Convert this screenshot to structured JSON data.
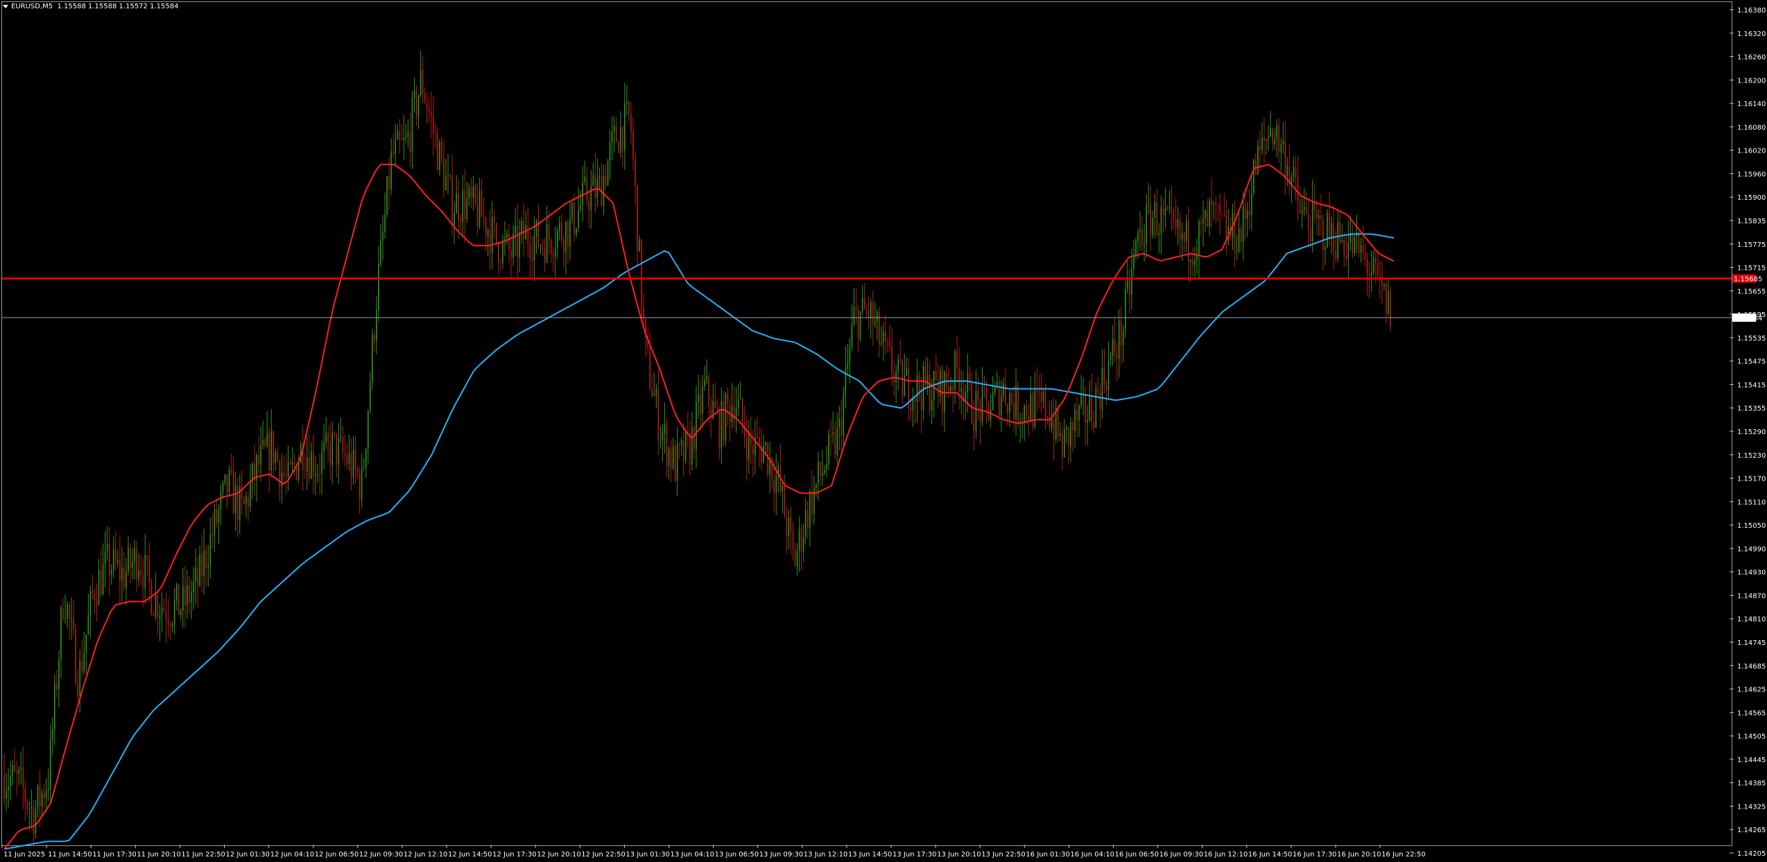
{
  "header": {
    "symbol": "EURUSD,M5",
    "ohlc": "1.15588 1.15588 1.15572 1.15584"
  },
  "colors": {
    "background": "#000000",
    "bull_candle": "#2e9a1e",
    "bear_candle": "#b41e1e",
    "ma_fast": "#ff2020",
    "ma_slow": "#22b4ff",
    "hline": "#e00000",
    "bid_line": "#9aa4ad"
  },
  "chart_data": {
    "type": "candlestick",
    "title": "",
    "xlabel": "",
    "ylabel": "",
    "grid": false,
    "ylim": [
      1.142,
      1.1638
    ],
    "y_ticks": [
      "1.16380",
      "1.16320",
      "1.16260",
      "1.16200",
      "1.16140",
      "1.16080",
      "1.16020",
      "1.15960",
      "1.15900",
      "1.15835",
      "1.15775",
      "1.15715",
      "1.15655",
      "1.15595",
      "1.15535",
      "1.15475",
      "1.15415",
      "1.15355",
      "1.15290",
      "1.15230",
      "1.15170",
      "1.15110",
      "1.15050",
      "1.14990",
      "1.14930",
      "1.14870",
      "1.14810",
      "1.14745",
      "1.14685",
      "1.14625",
      "1.14565",
      "1.14505",
      "1.14445",
      "1.14385",
      "1.14325",
      "1.14265",
      "1.14205"
    ],
    "x_ticks": [
      "11 Jun 2025",
      "11 Jun 14:50",
      "11 Jun 17:30",
      "11 Jun 20:10",
      "11 Jun 22:50",
      "12 Jun 01:30",
      "12 Jun 04:10",
      "12 Jun 06:50",
      "12 Jun 09:30",
      "12 Jun 12:10",
      "12 Jun 14:50",
      "12 Jun 17:30",
      "12 Jun 20:10",
      "12 Jun 22:50",
      "13 Jun 01:30",
      "13 Jun 04:10",
      "13 Jun 06:50",
      "13 Jun 09:30",
      "13 Jun 12:10",
      "13 Jun 14:50",
      "13 Jun 17:30",
      "13 Jun 20:10",
      "13 Jun 22:50",
      "16 Jun 01:30",
      "16 Jun 04:10",
      "16 Jun 06:50",
      "16 Jun 09:30",
      "16 Jun 12:10",
      "16 Jun 14:50",
      "16 Jun 17:30",
      "16 Jun 20:10",
      "16 Jun 22:50"
    ],
    "price_path": [
      1.144,
      1.1438,
      1.143,
      1.144,
      1.1488,
      1.1465,
      1.1488,
      1.1495,
      1.1492,
      1.1497,
      1.1486,
      1.1483,
      1.1484,
      1.149,
      1.1503,
      1.1515,
      1.1508,
      1.152,
      1.1525,
      1.1515,
      1.1525,
      1.152,
      1.1525,
      1.1522,
      1.1515,
      1.1565,
      1.16,
      1.1603,
      1.162,
      1.1603,
      1.1588,
      1.1588,
      1.1585,
      1.1578,
      1.1575,
      1.158,
      1.1578,
      1.158,
      1.1582,
      1.159,
      1.1592,
      1.1605,
      1.161,
      1.155,
      1.153,
      1.152,
      1.1525,
      1.154,
      1.153,
      1.1538,
      1.1525,
      1.1525,
      1.1515,
      1.1495,
      1.151,
      1.152,
      1.1528,
      1.1558,
      1.156,
      1.155,
      1.1542,
      1.154,
      1.154,
      1.154,
      1.1545,
      1.1535,
      1.1535,
      1.154,
      1.1535,
      1.1535,
      1.1535,
      1.1525,
      1.1532,
      1.1535,
      1.1545,
      1.1555,
      1.1578,
      1.1585,
      1.1582,
      1.1578,
      1.1578,
      1.1585,
      1.158,
      1.158,
      1.1598,
      1.1608,
      1.16,
      1.1585,
      1.1582,
      1.158,
      1.1578,
      1.1575,
      1.1568,
      1.156
    ],
    "ma_fast": [
      1.1421,
      1.1426,
      1.1427,
      1.1433,
      1.1448,
      1.1462,
      1.1475,
      1.1484,
      1.1485,
      1.1485,
      1.1488,
      1.1497,
      1.1505,
      1.151,
      1.1512,
      1.1513,
      1.1517,
      1.1518,
      1.1515,
      1.1522,
      1.154,
      1.156,
      1.1575,
      1.159,
      1.1598,
      1.1598,
      1.1595,
      1.159,
      1.1586,
      1.1581,
      1.1577,
      1.1577,
      1.1578,
      1.158,
      1.1582,
      1.1585,
      1.1588,
      1.159,
      1.1592,
      1.1588,
      1.157,
      1.1555,
      1.1545,
      1.1533,
      1.1527,
      1.1532,
      1.1535,
      1.1532,
      1.1527,
      1.1522,
      1.1515,
      1.1513,
      1.1513,
      1.1515,
      1.1528,
      1.1538,
      1.1542,
      1.1543,
      1.1542,
      1.1542,
      1.1539,
      1.1539,
      1.1535,
      1.1534,
      1.1532,
      1.1531,
      1.1532,
      1.1532,
      1.1538,
      1.1548,
      1.156,
      1.1568,
      1.1574,
      1.1575,
      1.1573,
      1.1574,
      1.1575,
      1.1574,
      1.1576,
      1.1585,
      1.1597,
      1.1598,
      1.1595,
      1.159,
      1.1588,
      1.1587,
      1.1585,
      1.158,
      1.1575,
      1.1573
    ],
    "ma_slow": [
      1.1421,
      1.1422,
      1.1423,
      1.1423,
      1.143,
      1.144,
      1.145,
      1.1457,
      1.1462,
      1.1467,
      1.1472,
      1.1478,
      1.1485,
      1.149,
      1.1495,
      1.1499,
      1.1503,
      1.1506,
      1.1508,
      1.1514,
      1.1523,
      1.1535,
      1.1545,
      1.155,
      1.1554,
      1.1557,
      1.156,
      1.1563,
      1.1566,
      1.157,
      1.1573,
      1.1576,
      1.1567,
      1.1563,
      1.1559,
      1.1555,
      1.1553,
      1.1552,
      1.1549,
      1.1545,
      1.1542,
      1.1536,
      1.1535,
      1.154,
      1.1542,
      1.1542,
      1.1541,
      1.154,
      1.154,
      1.154,
      1.1539,
      1.1538,
      1.1537,
      1.1538,
      1.154,
      1.1547,
      1.1554,
      1.156,
      1.1564,
      1.1568,
      1.1575,
      1.1577,
      1.1579,
      1.158,
      1.158,
      1.1579
    ],
    "hline_price": "1.15685",
    "bid_price": "1.15584"
  }
}
